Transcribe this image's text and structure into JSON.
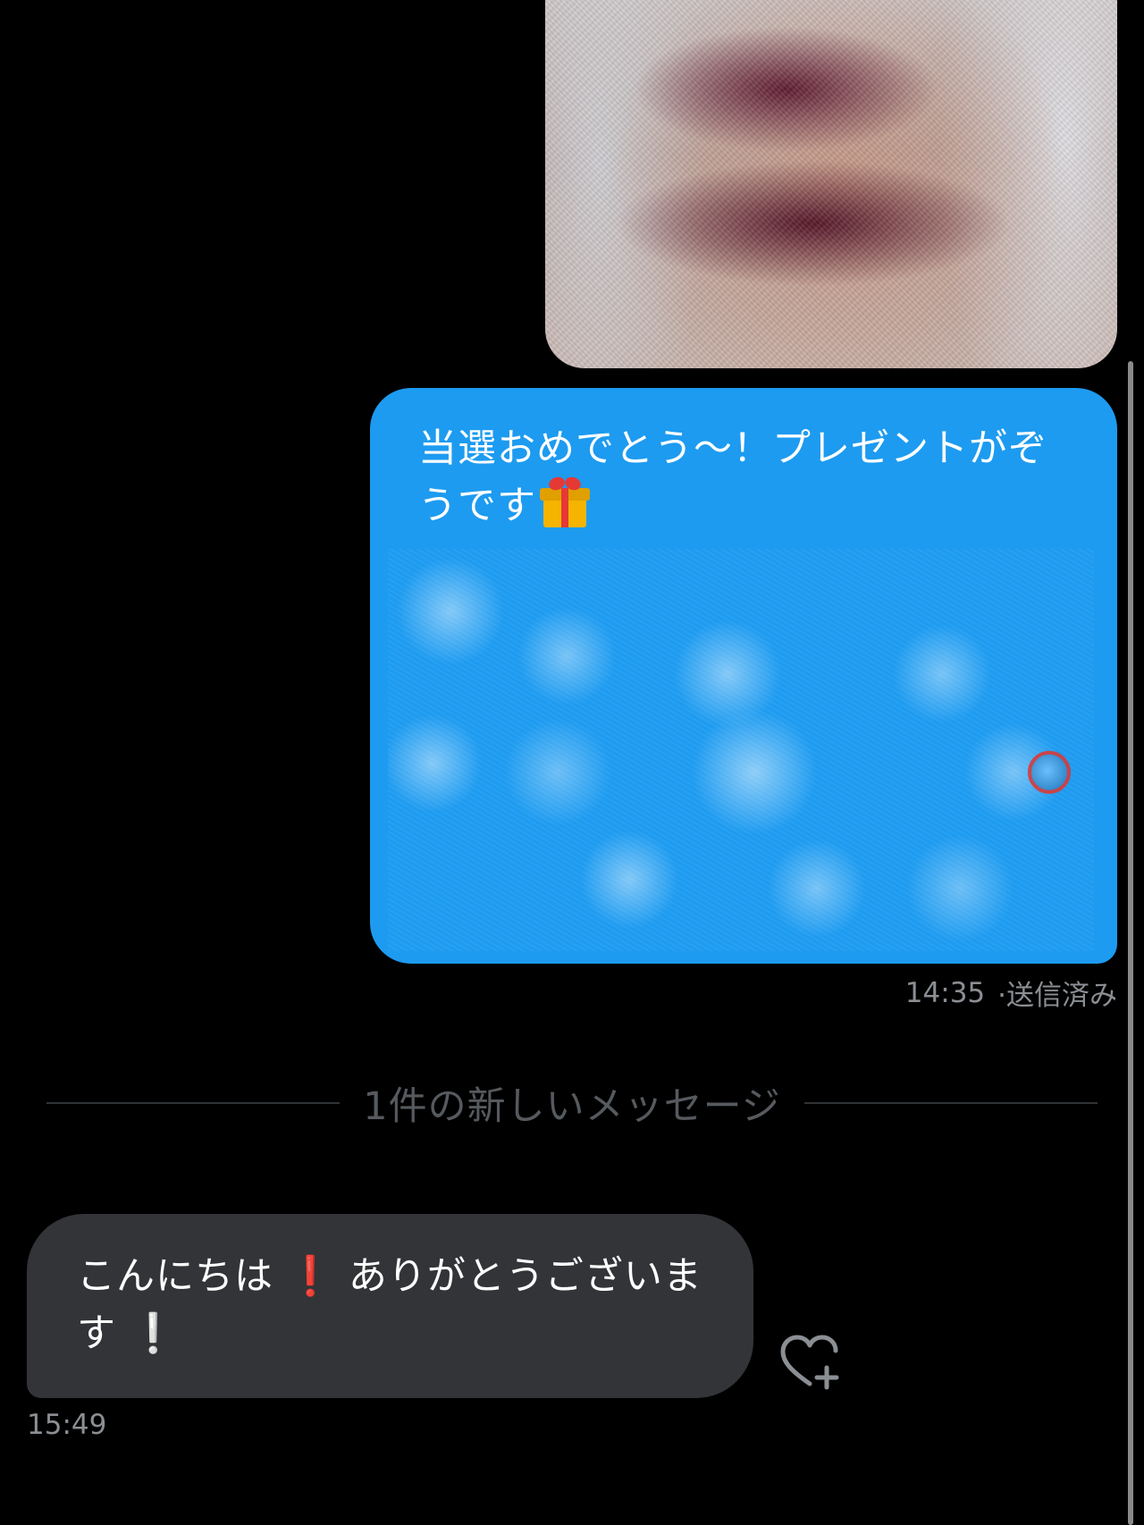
{
  "conversation": {
    "sent_message": {
      "text": "当選おめでとう〜！プレゼントがぞうです",
      "time": "14:35",
      "status": "·送信済み",
      "emoji_icon": "gift-icon",
      "bubble_color": "#1d9bf0"
    },
    "new_messages_divider": {
      "label": "1件の新しいメッセージ"
    },
    "received_message": {
      "text_part1": "こんにちは",
      "text_part2": "ありがとうございます",
      "bang1": "❗",
      "bang2": "❕",
      "time": "15:49",
      "bubble_color": "#333437"
    },
    "reaction_button": {
      "icon": "heart-plus-icon"
    }
  }
}
